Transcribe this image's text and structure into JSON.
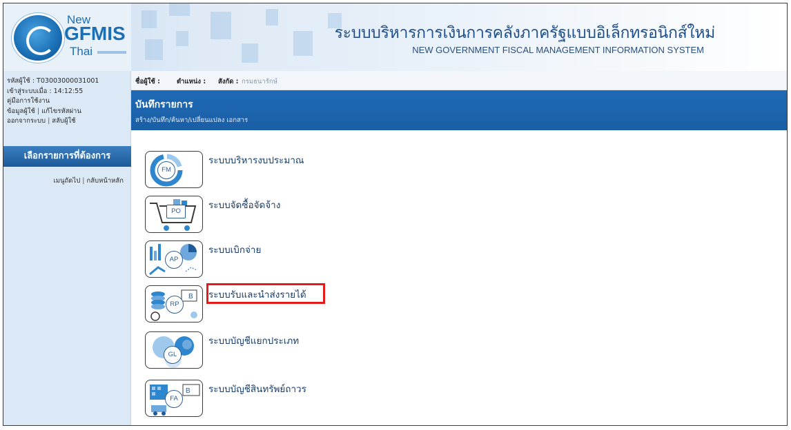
{
  "header": {
    "logo_new": "New",
    "logo_gfmis": "GFMIS",
    "logo_thai": "Thai",
    "title_th": "ระบบบริหารการเงินการคลังภาครัฐแบบอิเล็กทรอนิกส์ใหม่",
    "title_en": "NEW GOVERNMENT FISCAL MANAGEMENT INFORMATION SYSTEM"
  },
  "sidebar": {
    "user_code": "รหัสผู้ใช้ : T03003000031001",
    "login_time": "เข้าสู่ระบบเมื่อ : 14:12:55",
    "manual": "คู่มือการใช้งาน",
    "user_info": "ข้อมูลผู้ใช้",
    "change_password": "แก้ไขรหัสผ่าน",
    "logout": "ออกจากระบบ",
    "switch_user": "สลับผู้ใช้",
    "menu_button": "เลือกรายการที่ต้องการ",
    "main_menu": "เมนูถัดไป",
    "home": "กลับหน้าหลัก"
  },
  "topbar": {
    "user_label": "ชื่อผู้ใช้ :",
    "position_label": "ตำแหน่ง :",
    "dept_label": "สังกัด :",
    "dept_value": "กรมธนารักษ์"
  },
  "banner": {
    "title": "บันทึกรายการ",
    "subtitle": "สร้าง/บันทึก/ค้นหา/เปลี่ยนแปลง เอกสาร"
  },
  "modules": [
    {
      "code": "FM",
      "label": "ระบบบริหารงบประมาณ"
    },
    {
      "code": "PO",
      "label": "ระบบจัดซื้อจัดจ้าง"
    },
    {
      "code": "AP",
      "label": "ระบบเบิกจ่าย"
    },
    {
      "code": "RP",
      "label": "ระบบรับและนำส่งรายได้"
    },
    {
      "code": "GL",
      "label": "ระบบบัญชีแยกประเภท"
    },
    {
      "code": "FA",
      "label": "ระบบบัญชีสินทรัพย์ถาวร"
    }
  ],
  "colors": {
    "highlight": "#e31b1b",
    "banner": "#1f69b4",
    "menu_button": "#2a6cad"
  }
}
